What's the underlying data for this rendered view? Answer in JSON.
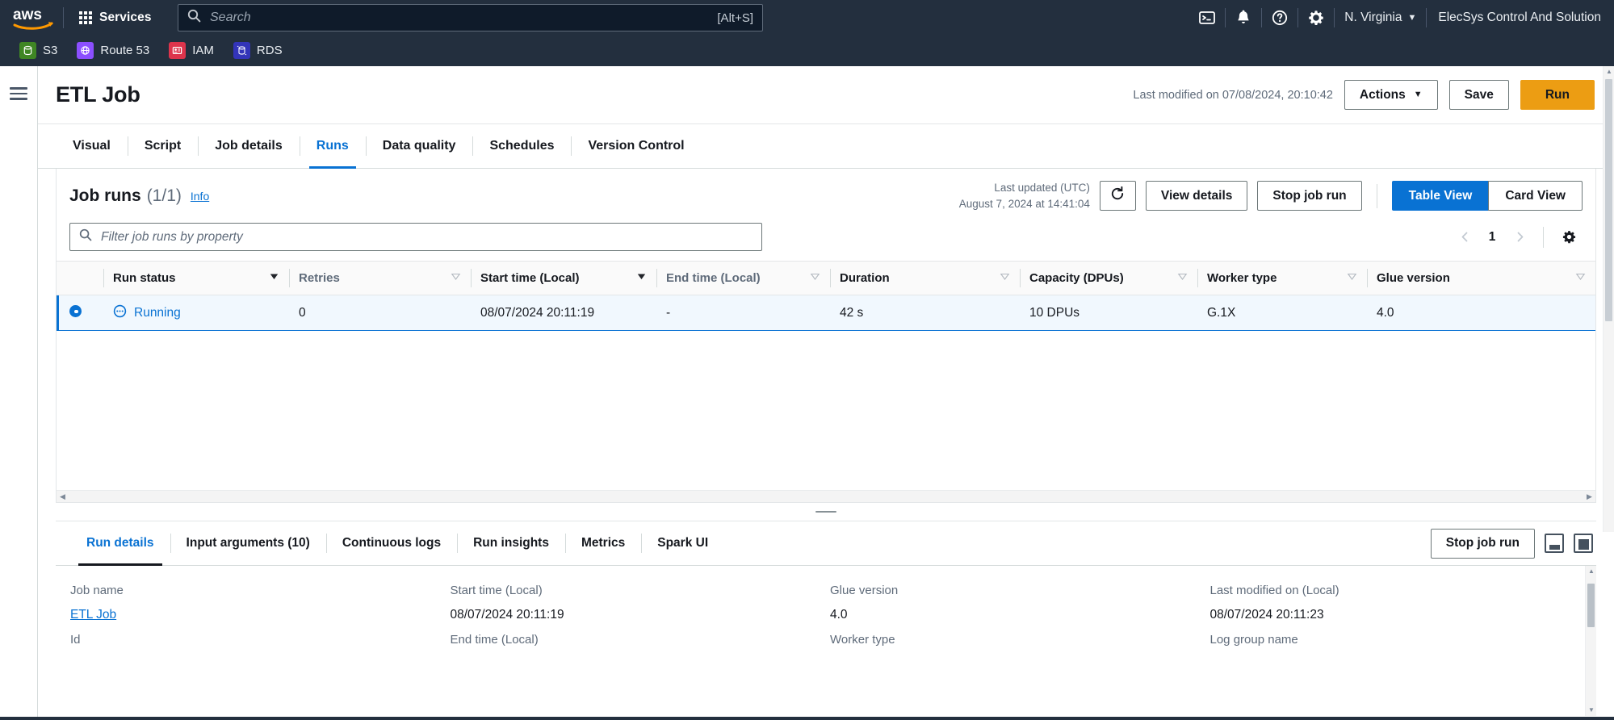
{
  "topnav": {
    "logo_alt": "aws",
    "services_label": "Services",
    "search": {
      "placeholder": "Search",
      "value": "",
      "shortcut": "[Alt+S]"
    },
    "icons": [
      "cloudshell-icon",
      "notifications-icon",
      "help-icon",
      "settings-icon"
    ],
    "region": "N. Virginia",
    "account": "ElecSys Control And Solution"
  },
  "favorites": [
    {
      "label": "S3",
      "color": "#3f8624"
    },
    {
      "label": "Route 53",
      "color": "#8c4fff"
    },
    {
      "label": "IAM",
      "color": "#dd344c"
    },
    {
      "label": "RDS",
      "color": "#3334b9"
    }
  ],
  "header": {
    "title": "ETL Job",
    "last_modified": "Last modified on 07/08/2024, 20:10:42",
    "actions_label": "Actions",
    "save_label": "Save",
    "run_label": "Run"
  },
  "tabs": [
    {
      "label": "Visual",
      "active": false
    },
    {
      "label": "Script",
      "active": false
    },
    {
      "label": "Job details",
      "active": false
    },
    {
      "label": "Runs",
      "active": true
    },
    {
      "label": "Data quality",
      "active": false
    },
    {
      "label": "Schedules",
      "active": false
    },
    {
      "label": "Version Control",
      "active": false
    }
  ],
  "job_runs": {
    "title": "Job runs",
    "count": "(1/1)",
    "info_label": "Info",
    "last_updated_label": "Last updated (UTC)",
    "last_updated_value": "August 7, 2024 at 14:41:04",
    "refresh_icon": "refresh-icon",
    "view_details_label": "View details",
    "stop_job_run_label": "Stop job run",
    "table_view_label": "Table View",
    "card_view_label": "Card View",
    "active_view": "Table View",
    "filter_placeholder": "Filter job runs by property",
    "filter_value": "",
    "page_number": "1",
    "columns": [
      {
        "label": "Run status",
        "dim": false
      },
      {
        "label": "Retries",
        "dim": true
      },
      {
        "label": "Start time (Local)",
        "dim": false
      },
      {
        "label": "End time (Local)",
        "dim": true
      },
      {
        "label": "Duration",
        "dim": false
      },
      {
        "label": "Capacity (DPUs)",
        "dim": false
      },
      {
        "label": "Worker type",
        "dim": false
      },
      {
        "label": "Glue version",
        "dim": false
      }
    ],
    "rows": [
      {
        "selected": true,
        "run_status": "Running",
        "status_icon": "in-progress-icon",
        "retries": "0",
        "start_time": "08/07/2024 20:11:19",
        "end_time": "-",
        "duration": "42 s",
        "capacity": "10 DPUs",
        "worker_type": "G.1X",
        "glue_version": "4.0"
      }
    ]
  },
  "bottom_panel": {
    "tabs": [
      {
        "label": "Run details",
        "active": true
      },
      {
        "label": "Input arguments (10)",
        "active": false
      },
      {
        "label": "Continuous logs",
        "active": false
      },
      {
        "label": "Run insights",
        "active": false
      },
      {
        "label": "Metrics",
        "active": false
      },
      {
        "label": "Spark UI",
        "active": false
      }
    ],
    "stop_job_run_label": "Stop job run",
    "pane_icons": [
      "split-pane-icon",
      "full-pane-icon"
    ],
    "columns": [
      {
        "fields": [
          {
            "label": "Job name",
            "value": "ETL Job",
            "link": true
          },
          {
            "label": "Id",
            "value": "",
            "link": false
          }
        ]
      },
      {
        "fields": [
          {
            "label": "Start time (Local)",
            "value": "08/07/2024 20:11:19",
            "link": false
          },
          {
            "label": "End time (Local)",
            "value": "",
            "link": false
          }
        ]
      },
      {
        "fields": [
          {
            "label": "Glue version",
            "value": "4.0",
            "link": false
          },
          {
            "label": "Worker type",
            "value": "",
            "link": false
          }
        ]
      },
      {
        "fields": [
          {
            "label": "Last modified on (Local)",
            "value": "08/07/2024 20:11:23",
            "link": false
          },
          {
            "label": "Log group name",
            "value": "",
            "link": false
          }
        ]
      }
    ]
  },
  "colors": {
    "nav_bg": "#232f3e",
    "accent_blue": "#0972d3",
    "accent_orange": "#ec9d13",
    "row_selected": "#f1f8fe"
  }
}
